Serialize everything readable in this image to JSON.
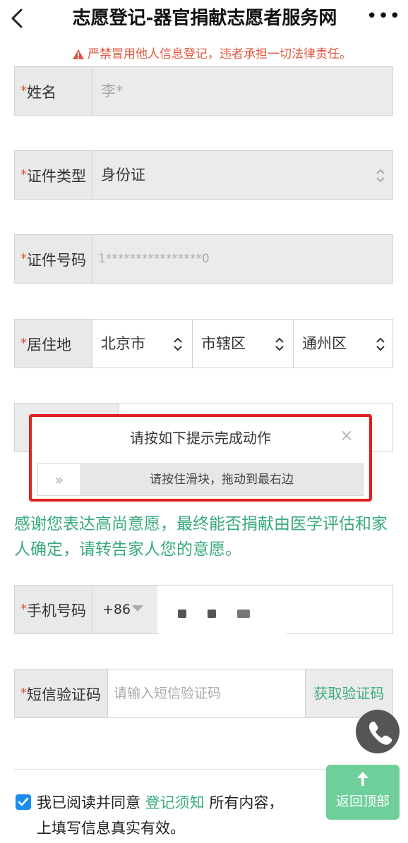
{
  "header": {
    "title": "志愿登记-器官捐献志愿者服务网",
    "back_icon": "chevron-left-icon",
    "more_label": "•••"
  },
  "warning": {
    "text": "严禁冒用他人信息登记，违者承担一切法律责任。",
    "color": "#e0543d"
  },
  "form": {
    "required_mark": "*",
    "name": {
      "label": "姓名",
      "value": "李*"
    },
    "id_type": {
      "label": "证件类型",
      "value": "身份证"
    },
    "id_number": {
      "label": "证件号码",
      "value": "1****************0"
    },
    "residence": {
      "label": "居住地",
      "province": "北京市",
      "city": "市辖区",
      "district": "通州区"
    },
    "phone": {
      "label": "手机号码",
      "country_code": "+86"
    },
    "sms": {
      "label": "短信验证码",
      "placeholder": "请输入短信验证码",
      "send_label": "获取验证码"
    }
  },
  "captcha": {
    "title": "请按如下提示完成动作",
    "close": "×",
    "handle": "»",
    "instruction": "请按住滑块，拖动到最右边"
  },
  "notice": {
    "text": "感谢您表达高尚意愿，最终能否捐献由医学评估和家人确定，请转告家人您的意愿。",
    "color": "#3aab7b"
  },
  "agreement": {
    "checked": true,
    "prefix": "我已阅读并同意",
    "link": "登记须知",
    "suffix": "所有内容，",
    "line2": "上填写信息真实有效。"
  },
  "fab": {
    "back_to_top": "返回顶部",
    "phone_icon": "phone-icon"
  },
  "colors": {
    "accent_green": "#3aab7b",
    "alert_red": "#e02020",
    "checkbox_blue": "#1a8cf0"
  }
}
